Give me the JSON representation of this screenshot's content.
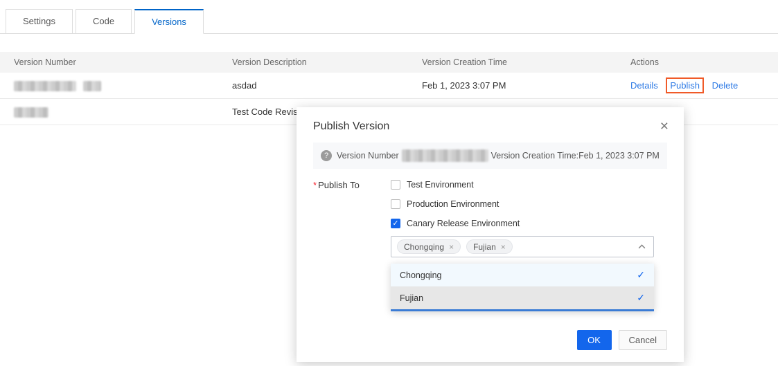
{
  "icons": {
    "close": "×",
    "check": "✓",
    "help": "?",
    "remove": "×"
  },
  "tabs": [
    {
      "label": "Settings",
      "active": false
    },
    {
      "label": "Code",
      "active": false
    },
    {
      "label": "Versions",
      "active": true
    }
  ],
  "table": {
    "headers": [
      "Version Number",
      "Version Description",
      "Version Creation Time",
      "Actions"
    ],
    "rows": [
      {
        "version_number": "(redacted)",
        "description": "asdad",
        "creation_time": "Feb 1, 2023 3:07 PM",
        "actions": {
          "details": "Details",
          "publish": "Publish",
          "delete": "Delete"
        }
      },
      {
        "version_number": "(redacted)",
        "description": "Test Code Revision"
      }
    ]
  },
  "modal": {
    "title": "Publish Version",
    "info": {
      "version_number_label": "Version Number",
      "version_number_value": "(redacted)",
      "creation_time_text": "Version Creation Time:Feb 1, 2023 3:07 PM"
    },
    "form": {
      "required_marker": "*",
      "publish_to_label": "Publish To",
      "checkboxes": [
        {
          "label": "Test Environment",
          "checked": false
        },
        {
          "label": "Production Environment",
          "checked": false
        },
        {
          "label": "Canary Release Environment",
          "checked": true
        }
      ],
      "tags": [
        {
          "label": "Chongqing"
        },
        {
          "label": "Fujian"
        }
      ],
      "options": [
        {
          "label": "Chongqing",
          "selected": true
        },
        {
          "label": "Fujian",
          "selected": true
        }
      ]
    },
    "footer": {
      "ok": "OK",
      "cancel": "Cancel"
    }
  },
  "colors": {
    "accent": "#0064c8",
    "button": "#1366ec",
    "link": "#2d7ae5",
    "highlight_box": "#f05a28",
    "required": "#f5222d"
  }
}
